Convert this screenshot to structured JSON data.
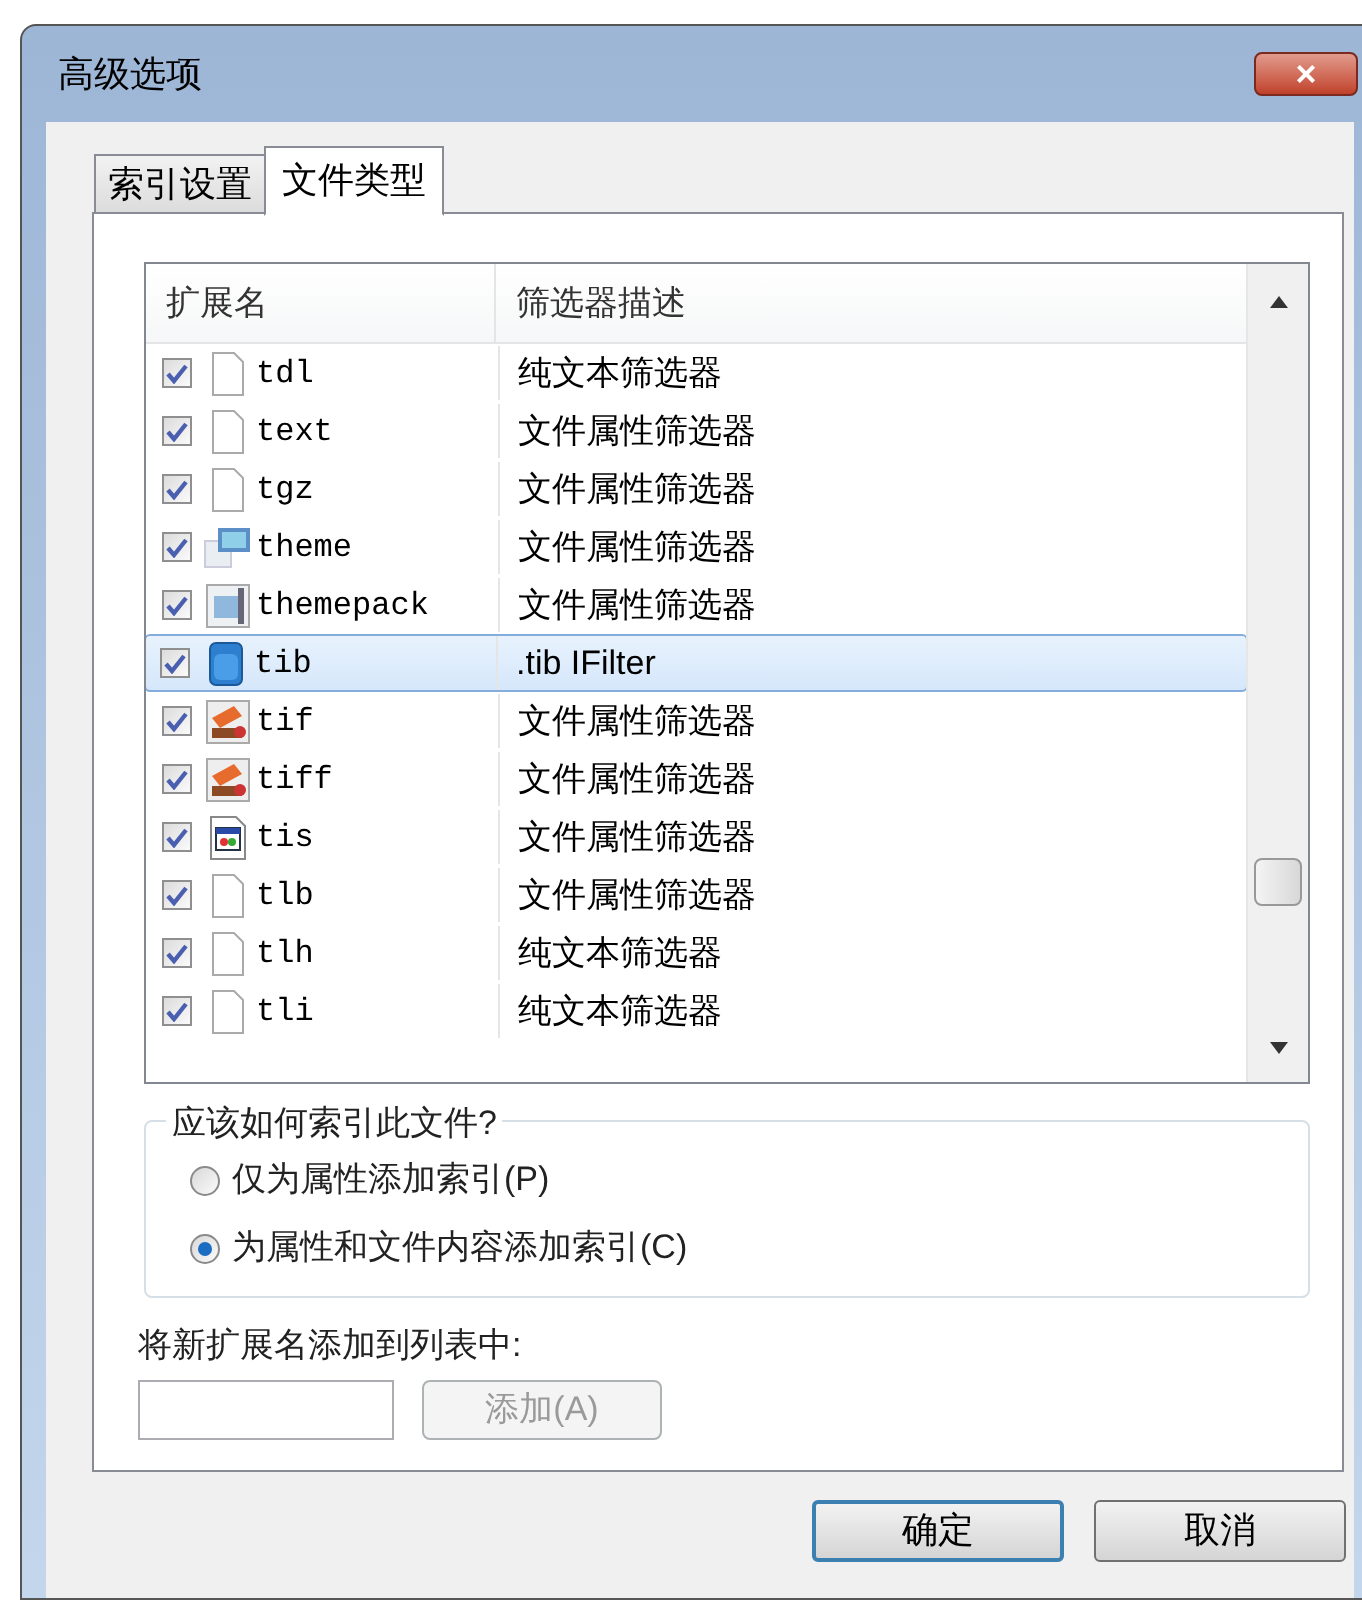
{
  "window": {
    "title": "高级选项",
    "close_label": "×"
  },
  "tabs": [
    {
      "label": "索引设置",
      "selected": false
    },
    {
      "label": "文件类型",
      "selected": true
    }
  ],
  "table": {
    "columns": [
      "扩展名",
      "筛选器描述"
    ],
    "rows": [
      {
        "ext": "tdl",
        "desc": "纯文本筛选器",
        "checked": true,
        "kind": "blank",
        "selected": false
      },
      {
        "ext": "text",
        "desc": "文件属性筛选器",
        "checked": true,
        "kind": "blank",
        "selected": false
      },
      {
        "ext": "tgz",
        "desc": "文件属性筛选器",
        "checked": true,
        "kind": "blank",
        "selected": false
      },
      {
        "ext": "theme",
        "desc": "文件属性筛选器",
        "checked": true,
        "kind": "theme",
        "selected": false
      },
      {
        "ext": "themepack",
        "desc": "文件属性筛选器",
        "checked": true,
        "kind": "pack",
        "selected": false
      },
      {
        "ext": "tib",
        "desc": ".tib IFilter",
        "checked": true,
        "kind": "disk",
        "selected": true
      },
      {
        "ext": "tif",
        "desc": "文件属性筛选器",
        "checked": true,
        "kind": "image",
        "selected": false
      },
      {
        "ext": "tiff",
        "desc": "文件属性筛选器",
        "checked": true,
        "kind": "image",
        "selected": false
      },
      {
        "ext": "tis",
        "desc": "文件属性筛选器",
        "checked": true,
        "kind": "app",
        "selected": false
      },
      {
        "ext": "tlb",
        "desc": "文件属性筛选器",
        "checked": true,
        "kind": "blank",
        "selected": false
      },
      {
        "ext": "tlh",
        "desc": "纯文本筛选器",
        "checked": true,
        "kind": "blank",
        "selected": false
      },
      {
        "ext": "tli",
        "desc": "纯文本筛选器",
        "checked": true,
        "kind": "blank",
        "selected": false
      }
    ]
  },
  "index_group": {
    "title": "应该如何索引此文件?",
    "options": [
      {
        "label": "仅为属性添加索引(P)",
        "selected": false
      },
      {
        "label": "为属性和文件内容添加索引(C)",
        "selected": true
      }
    ]
  },
  "add_extension": {
    "label": "将新扩展名添加到列表中:",
    "button": "添加(A)",
    "button_disabled": true
  },
  "buttons": [
    "确定",
    "取消"
  ]
}
